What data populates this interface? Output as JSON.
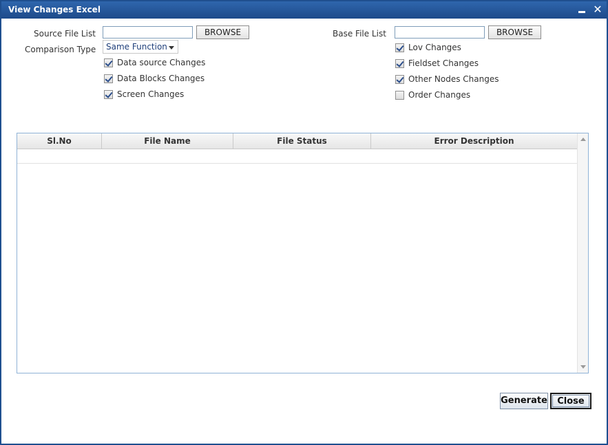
{
  "window": {
    "title": "View Changes Excel"
  },
  "source": {
    "label": "Source File List",
    "value": "",
    "browse_label": "BROWSE"
  },
  "base": {
    "label": "Base File List",
    "value": "",
    "browse_label": "BROWSE"
  },
  "comparison": {
    "label": "Comparison Type",
    "selected": "Same Function"
  },
  "checkboxes_left": [
    {
      "label": "Data source Changes",
      "checked": true
    },
    {
      "label": "Data Blocks Changes",
      "checked": true
    },
    {
      "label": "Screen Changes",
      "checked": true
    }
  ],
  "checkboxes_right": [
    {
      "label": "Lov Changes",
      "checked": true
    },
    {
      "label": "Fieldset Changes",
      "checked": true
    },
    {
      "label": "Other Nodes Changes",
      "checked": true
    },
    {
      "label": "Order Changes",
      "checked": false
    }
  ],
  "grid": {
    "columns": [
      "Sl.No",
      "File Name",
      "File Status",
      "Error Description"
    ],
    "rows": []
  },
  "actions": {
    "generate_label": "Generate",
    "close_label": "Close"
  }
}
